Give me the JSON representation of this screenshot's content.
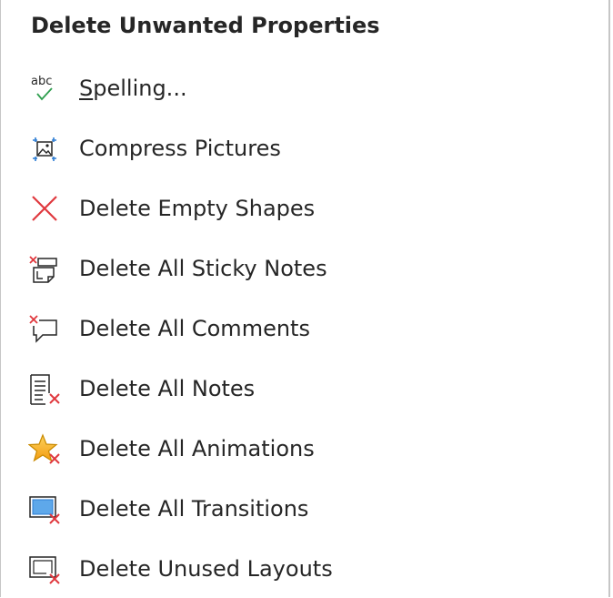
{
  "menu": {
    "header": "Delete Unwanted Properties",
    "items": [
      {
        "id": "spelling",
        "accel": "S",
        "rest": "pelling...",
        "icon": "spelling-abc-check-icon",
        "icon_text": "abc"
      },
      {
        "id": "compress-pictures",
        "label": "Compress Pictures",
        "icon": "compress-pictures-icon"
      },
      {
        "id": "delete-empty-shapes",
        "label": "Delete Empty Shapes",
        "icon": "red-x-icon"
      },
      {
        "id": "delete-all-sticky-notes",
        "label": "Delete All Sticky Notes",
        "icon": "delete-sticky-notes-icon"
      },
      {
        "id": "delete-all-comments",
        "label": "Delete All Comments",
        "icon": "delete-comments-icon"
      },
      {
        "id": "delete-all-notes",
        "label": "Delete All Notes",
        "icon": "delete-notes-icon"
      },
      {
        "id": "delete-all-animations",
        "label": "Delete All Animations",
        "icon": "delete-animations-star-icon"
      },
      {
        "id": "delete-all-transitions",
        "label": "Delete All Transitions",
        "icon": "delete-transitions-icon"
      },
      {
        "id": "delete-unused-layouts",
        "label": "Delete Unused Layouts",
        "icon": "delete-unused-layouts-icon"
      }
    ]
  },
  "colors": {
    "text": "#262626",
    "red": "#e0383e",
    "green": "#2e9e4e",
    "blue": "#2b7cd3",
    "gold": "#f5b301"
  }
}
